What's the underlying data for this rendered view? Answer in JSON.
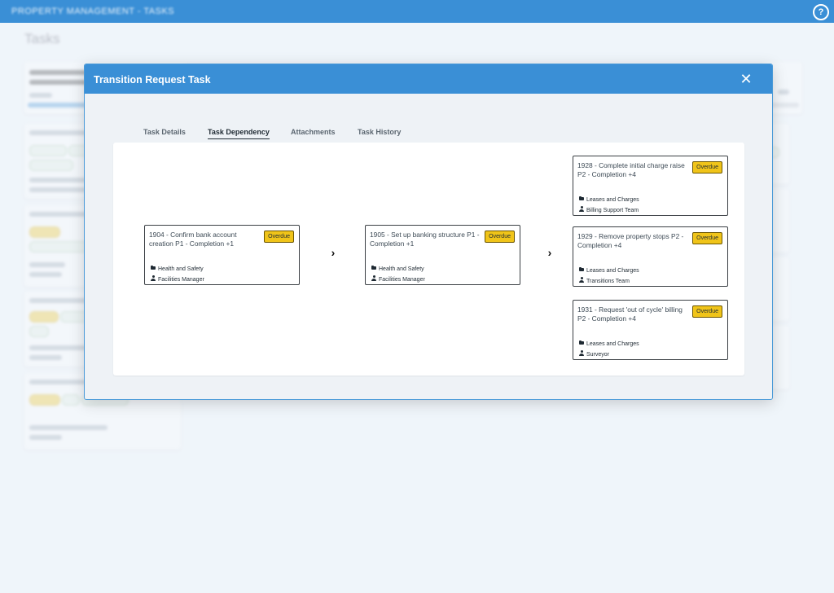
{
  "app": {
    "title": "PROPERTY MANAGEMENT - TASKS",
    "help_icon": "help-circle-icon",
    "page_title": "Tasks"
  },
  "colors": {
    "brand": "#3a8fd6",
    "overdue": "#f0c419"
  },
  "modal": {
    "title": "Transition Request Task",
    "close_icon": "close-icon",
    "tabs": [
      {
        "label": "Task Details",
        "active": false
      },
      {
        "label": "Task Dependency",
        "active": true
      },
      {
        "label": "Attachments",
        "active": false
      },
      {
        "label": "Task History",
        "active": false
      }
    ],
    "dependency": {
      "arrow_glyph": "›",
      "columns": [
        [
          {
            "title": "1904 - Confirm bank account creation P1 - Completion +1",
            "status": "Overdue",
            "category": "Health and Safety",
            "assignee": "Facilities Manager"
          }
        ],
        [
          {
            "title": "1905 - Set up banking structure P1 - Completion +1",
            "status": "Overdue",
            "category": "Health and Safety",
            "assignee": "Facilities Manager"
          }
        ],
        [
          {
            "title": "1928 - Complete initial charge raise P2 - Completion +4",
            "status": "Overdue",
            "category": "Leases and Charges",
            "assignee": "Billing Support Team"
          },
          {
            "title": "1929 - Remove property stops P2 - Completion +4",
            "status": "Overdue",
            "category": "Leases and Charges",
            "assignee": "Transitions Team"
          },
          {
            "title": "1931 - Request 'out of cycle' billing P2 - Completion +4",
            "status": "Overdue",
            "category": "Leases and Charges",
            "assignee": "Surveyor"
          }
        ]
      ]
    }
  }
}
